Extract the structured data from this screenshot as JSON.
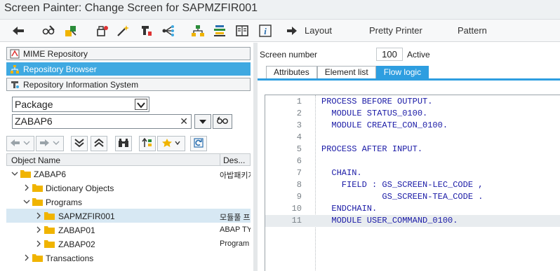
{
  "window": {
    "title": "Screen Painter: Change Screen for SAPMZFIR001"
  },
  "toolbar": {
    "layout_label": "Layout",
    "pretty_printer_label": "Pretty Printer",
    "pattern_label": "Pattern"
  },
  "nav": {
    "mime_repository": "MIME Repository",
    "repository_browser": "Repository Browser",
    "repository_info_system": "Repository Information System"
  },
  "browser": {
    "object_type": "Package",
    "object_name": "ZABAP6"
  },
  "grid": {
    "col_object_name": "Object Name",
    "col_description": "Des..."
  },
  "tree": [
    {
      "label": "ZABAP6",
      "desc": "아밥패키지"
    },
    {
      "label": "Dictionary Objects",
      "desc": ""
    },
    {
      "label": "Programs",
      "desc": ""
    },
    {
      "label": "SAPMZFIR001",
      "desc": "모듈풀 프"
    },
    {
      "label": "ZABAP01",
      "desc": "ABAP TY"
    },
    {
      "label": "ZABAP02",
      "desc": "Program"
    },
    {
      "label": "Transactions",
      "desc": ""
    }
  ],
  "screen": {
    "label": "Screen number",
    "number": "100",
    "status": "Active"
  },
  "tabs": [
    {
      "label": "Attributes"
    },
    {
      "label": "Element list"
    },
    {
      "label": "Flow logic"
    }
  ],
  "code": [
    {
      "n": "1",
      "text": "PROCESS BEFORE OUTPUT."
    },
    {
      "n": "2",
      "text": "  MODULE STATUS_0100."
    },
    {
      "n": "3",
      "text": "  MODULE CREATE_CON_0100."
    },
    {
      "n": "4",
      "text": ""
    },
    {
      "n": "5",
      "text": "PROCESS AFTER INPUT."
    },
    {
      "n": "6",
      "text": ""
    },
    {
      "n": "7",
      "text": "  CHAIN."
    },
    {
      "n": "8",
      "text": "    FIELD : GS_SCREEN-LEC_CODE ,"
    },
    {
      "n": "9",
      "text": "            GS_SCREEN-TEA_CODE ."
    },
    {
      "n": "10",
      "text": "  ENDCHAIN."
    },
    {
      "n": "11",
      "text": "  MODULE USER_COMMAND_0100."
    }
  ],
  "colors": {
    "accent": "#3fa9e1",
    "code": "#1a1aa6",
    "folder": "#f0b400"
  }
}
